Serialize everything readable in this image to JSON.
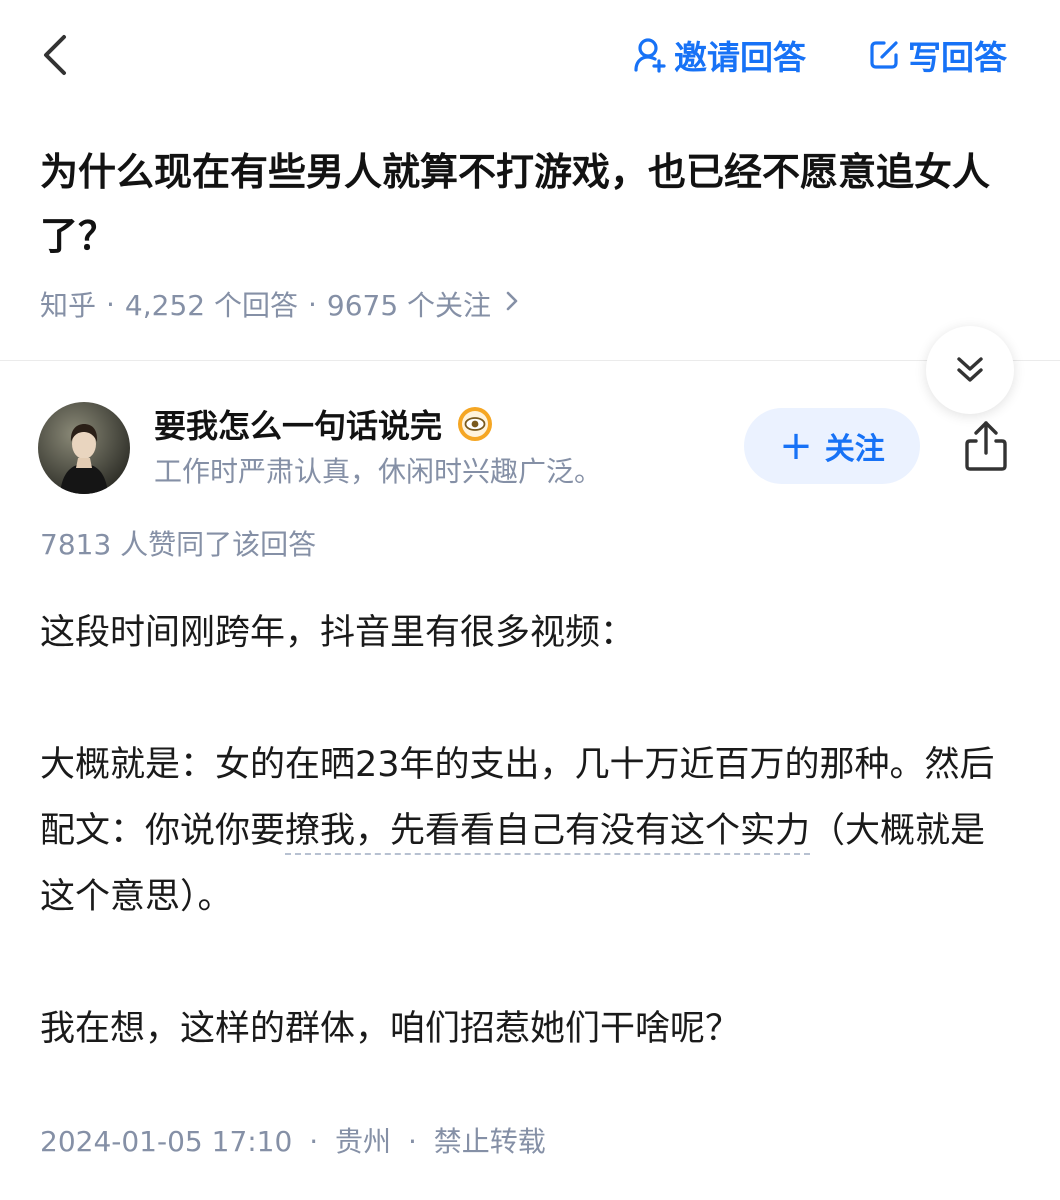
{
  "nav": {
    "invite_label": "邀请回答",
    "write_label": "写回答",
    "icons": {
      "back": "chevron-left-icon",
      "invite": "person-add-icon",
      "write": "edit-icon"
    },
    "accent_color": "#1772f6"
  },
  "question": {
    "title": "为什么现在有些男人就算不打游戏，也已经不愿意追女人了？",
    "source": "知乎",
    "answers": "4,252 个回答",
    "followers": "9675 个关注"
  },
  "author": {
    "name": "要我怎么一句话说完",
    "bio": "工作时严肃认真，休闲时兴趣广泛。",
    "follow_label": "关注"
  },
  "answer": {
    "votes": "7813 人赞同了该回答",
    "p1": "这段时间刚跨年，抖音里有很多视频：",
    "p2_a": "大概就是：女的在晒23年的支出，几十万近百万的那种。然后配文：你说你要",
    "p2_kw1": "撩我，先看看自己有没有这个实力",
    "p2_b": "（大概就是这个意思）。",
    "p3": "我在想，这样的群体，咱们招惹她们干啥呢？",
    "date": "2024-01-05 17:10",
    "location": "贵州",
    "copyright": "禁止转载"
  }
}
